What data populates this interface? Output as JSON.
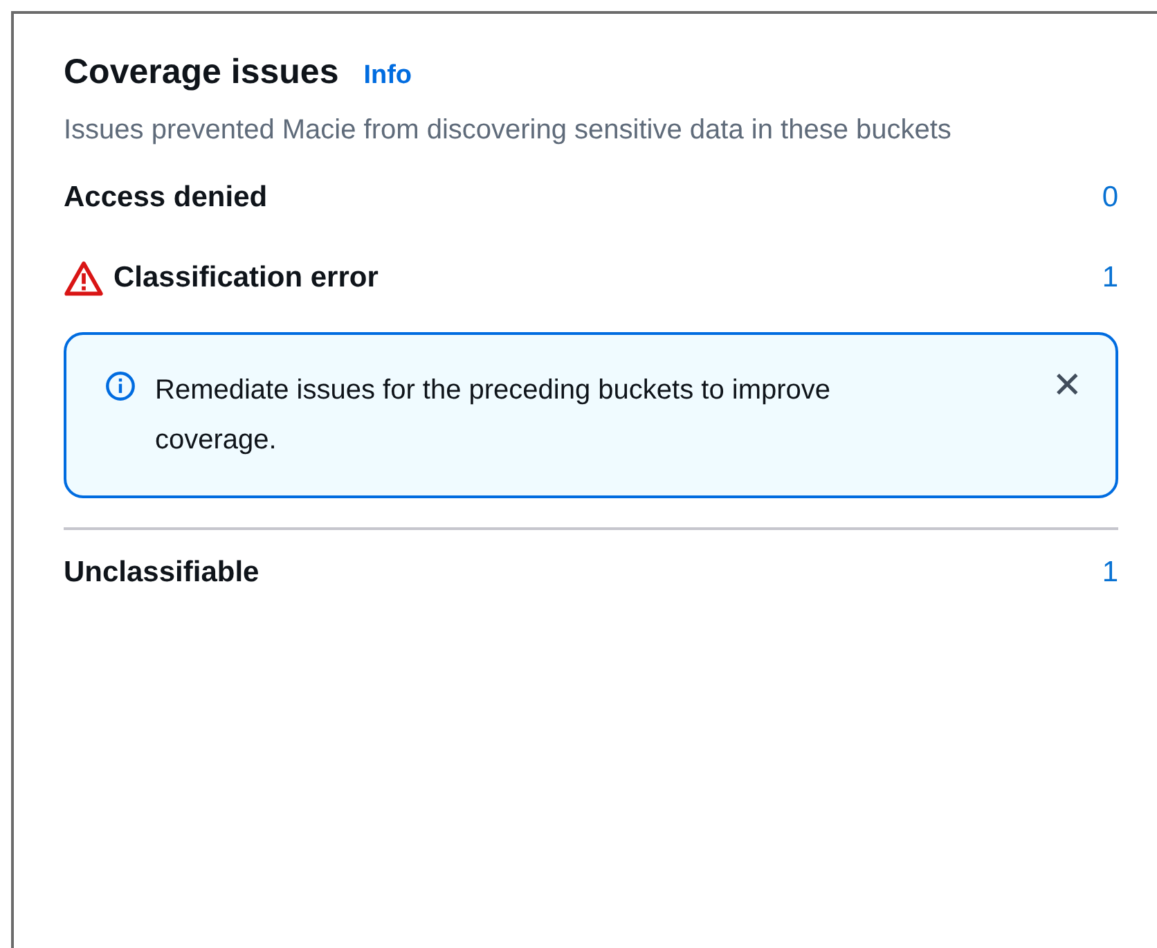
{
  "panel": {
    "title": "Coverage issues",
    "info_link": "Info",
    "description": "Issues prevented Macie from discovering sensitive data in these buckets"
  },
  "issues": [
    {
      "label": "Access denied",
      "count": "0",
      "warning": false
    },
    {
      "label": "Classification error",
      "count": "1",
      "warning": true,
      "alert": {
        "message": "Remediate issues for the preceding buckets to improve coverage.",
        "dismiss": "✕"
      }
    },
    {
      "label": "Unclassifiable",
      "count": "1",
      "warning": false
    }
  ]
}
